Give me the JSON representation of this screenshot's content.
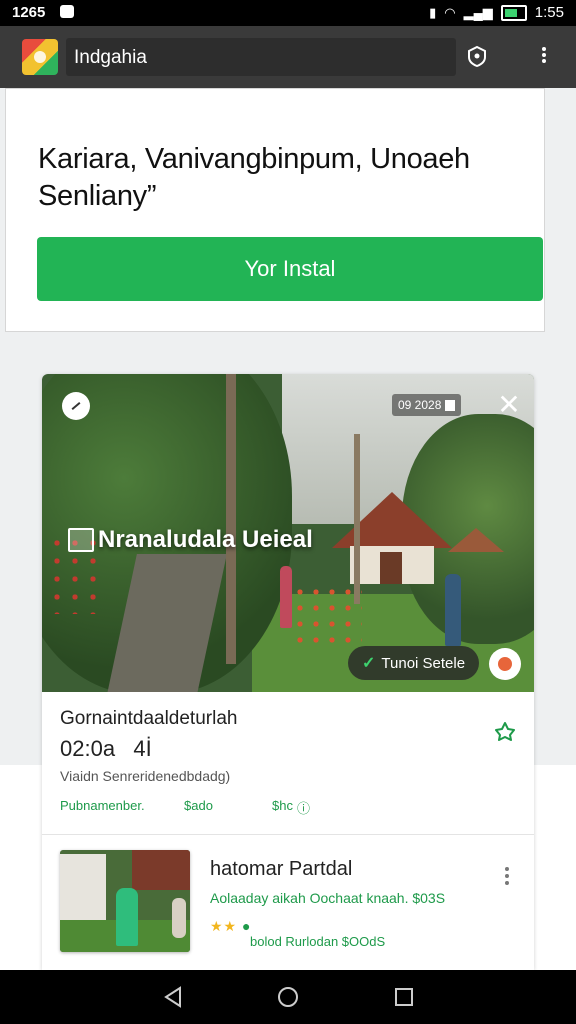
{
  "status_bar": {
    "left_time": "1265",
    "right_time": "1:55",
    "battery_color": "#3bd16f"
  },
  "toolbar": {
    "title": "Indgahia",
    "background": "#3a3a3a",
    "icons": [
      "shield-icon",
      "more-vert-icon"
    ]
  },
  "promo": {
    "text_line1": "Kariara, Vanivangbinpum, Unoaeh",
    "text_line2": "Senliany”",
    "install_label": "Yor Instal",
    "accent": "#22b455"
  },
  "feature_card": {
    "photo_caption": "Nranaludala Ueieal",
    "photo_tag": "09 2028",
    "close_glyph": "✕",
    "verify_label": "Tunoi Setele",
    "title": "Gornaintdaaldeturlah",
    "time": "02:0a   4İ",
    "subtitle": "Viaidn Senreridenedbdadg)",
    "links": [
      "Pubnamenber.",
      "$ado",
      "$hc"
    ]
  },
  "list_item": {
    "title": "hatomar Partdal",
    "line": "Aolaaday aikah Oochaat knaah. $03S",
    "stars": "★★",
    "meta": "bolod Rurlodan $OOdS"
  },
  "navbar": {
    "buttons": [
      "back-icon",
      "home-icon",
      "recents-icon"
    ]
  }
}
